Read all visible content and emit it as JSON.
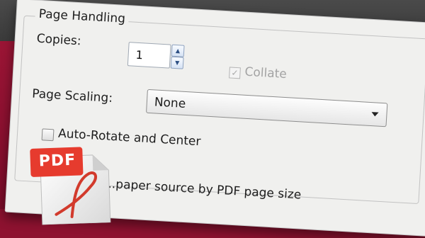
{
  "page_handling": {
    "title": "Page Handling",
    "copies_label": "Copies:",
    "copies_value": "1",
    "collate_label": "Collate",
    "collate_checked": true,
    "collate_disabled": true,
    "page_scaling_label": "Page Scaling:",
    "page_scaling_value": "None",
    "auto_rotate_label": "Auto-Rotate and Center",
    "auto_rotate_checked": false,
    "paper_source_label": "...paper source by PDF page size"
  },
  "pdf_icon": {
    "label": "PDF"
  },
  "colors": {
    "background": "#8e1230",
    "top_band": "#3f3f3f",
    "dialog": "#f0f0ee",
    "pdf_badge": "#e63b2e"
  },
  "icons": [
    "spin-up-icon",
    "spin-down-icon",
    "checkmark-icon",
    "chevron-down-icon",
    "pdf-file-icon"
  ]
}
